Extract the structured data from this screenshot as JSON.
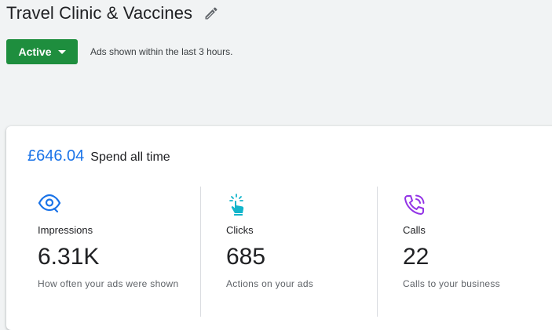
{
  "header": {
    "title": "Travel Clinic & Vaccines",
    "edit_icon": "pencil-icon"
  },
  "status": {
    "label": "Active",
    "note": "Ads shown within the last 3 hours.",
    "color": "#1e8e3e"
  },
  "spend": {
    "amount": "£646.04",
    "label": "Spend all time",
    "amount_color": "#1a73e8"
  },
  "metrics": [
    {
      "icon": "eye-icon",
      "label": "Impressions",
      "value": "6.31K",
      "description": "How often your ads were shown",
      "color": "#1a73e8"
    },
    {
      "icon": "tap-icon",
      "label": "Clicks",
      "value": "685",
      "description": "Actions on your ads",
      "color": "#12b5cb"
    },
    {
      "icon": "phone-call-icon",
      "label": "Calls",
      "value": "22",
      "description": "Calls to your business",
      "color": "#9334e6"
    }
  ]
}
